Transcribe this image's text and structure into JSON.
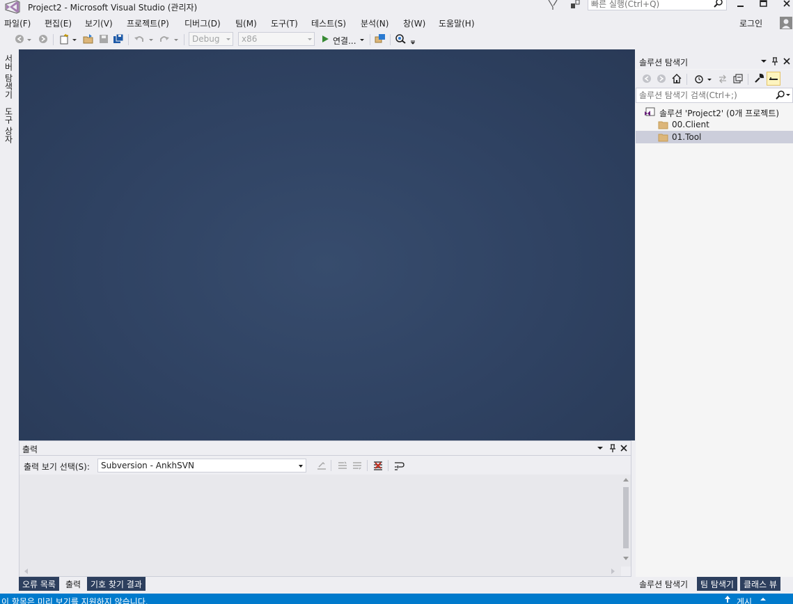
{
  "window": {
    "title": "Project2 - Microsoft Visual Studio (관리자)",
    "quick_launch_placeholder": "빠른 실행(Ctrl+Q)"
  },
  "menu": {
    "items": [
      "파일(F)",
      "편집(E)",
      "보기(V)",
      "프로젝트(P)",
      "디버그(D)",
      "팀(M)",
      "도구(T)",
      "테스트(S)",
      "분석(N)",
      "창(W)",
      "도움말(H)"
    ],
    "login": "로그인"
  },
  "toolbar": {
    "config": "Debug",
    "platform": "x86",
    "connect_label": "연결..."
  },
  "left_tabs": [
    "서버 탐색기",
    "도구 상자"
  ],
  "output": {
    "title": "출력",
    "source_label": "출력 보기 선택(S):",
    "source_value": "Subversion - AnkhSVN"
  },
  "bottom_tabs": [
    {
      "label": "오류 목록",
      "active": false
    },
    {
      "label": "출력",
      "active": true
    },
    {
      "label": "기호 찾기 결과",
      "active": false
    }
  ],
  "solution_explorer": {
    "title": "솔루션 탐색기",
    "search_placeholder": "솔루션 탐색기 검색(Ctrl+;)",
    "tree": [
      {
        "label": "솔루션 'Project2' (0개 프로젝트)",
        "icon": "solution-icon",
        "selected": false
      },
      {
        "label": "00.Client",
        "icon": "folder-icon",
        "selected": false
      },
      {
        "label": "01.Tool",
        "icon": "folder-icon",
        "selected": true
      }
    ]
  },
  "right_tabs": [
    {
      "label": "솔루션 탐색기",
      "active": true
    },
    {
      "label": "팀 탐색기",
      "active": false
    },
    {
      "label": "클래스 뷰",
      "active": false
    }
  ],
  "status": {
    "message": "이 항목은 미리 보기를 지원하지 않습니다.",
    "publish": "게시"
  },
  "colors": {
    "accent": "#007acc",
    "editor_bg": "#2f4262",
    "selected_row": "#cccedb"
  }
}
